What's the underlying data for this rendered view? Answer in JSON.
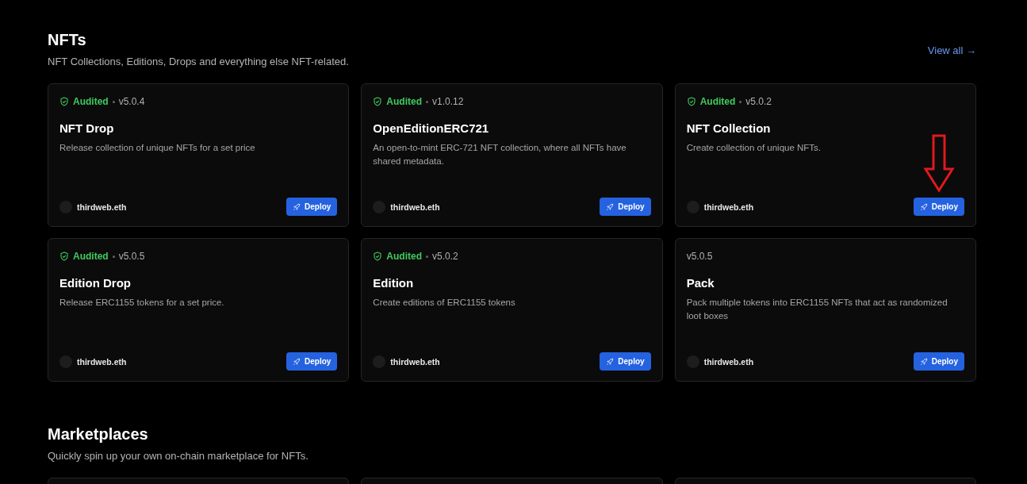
{
  "sections": [
    {
      "title": "NFTs",
      "subtitle": "NFT Collections, Editions, Drops and everything else NFT-related.",
      "view_all": "View all →",
      "cards": [
        {
          "audited": true,
          "audited_label": "Audited",
          "version": "v5.0.4",
          "name": "NFT Drop",
          "description": "Release collection of unique NFTs for a set price",
          "publisher": "thirdweb.eth",
          "button": "Deploy",
          "arrow": false
        },
        {
          "audited": true,
          "audited_label": "Audited",
          "version": "v1.0.12",
          "name": "OpenEditionERC721",
          "description": "An open-to-mint ERC-721 NFT collection, where all NFTs have shared metadata.",
          "publisher": "thirdweb.eth",
          "button": "Deploy",
          "arrow": false
        },
        {
          "audited": true,
          "audited_label": "Audited",
          "version": "v5.0.2",
          "name": "NFT Collection",
          "description": "Create collection of unique NFTs.",
          "publisher": "thirdweb.eth",
          "button": "Deploy",
          "arrow": true
        },
        {
          "audited": true,
          "audited_label": "Audited",
          "version": "v5.0.5",
          "name": "Edition Drop",
          "description": "Release ERC1155 tokens for a set price.",
          "publisher": "thirdweb.eth",
          "button": "Deploy",
          "arrow": false
        },
        {
          "audited": true,
          "audited_label": "Audited",
          "version": "v5.0.2",
          "name": "Edition",
          "description": "Create editions of ERC1155 tokens",
          "publisher": "thirdweb.eth",
          "button": "Deploy",
          "arrow": false
        },
        {
          "audited": false,
          "version": "v5.0.5",
          "name": "Pack",
          "description": "Pack multiple tokens into ERC1155 NFTs that act as randomized loot boxes",
          "publisher": "thirdweb.eth",
          "button": "Deploy",
          "arrow": false
        }
      ]
    },
    {
      "title": "Marketplaces",
      "subtitle": "Quickly spin up your own on-chain marketplace for NFTs."
    }
  ]
}
